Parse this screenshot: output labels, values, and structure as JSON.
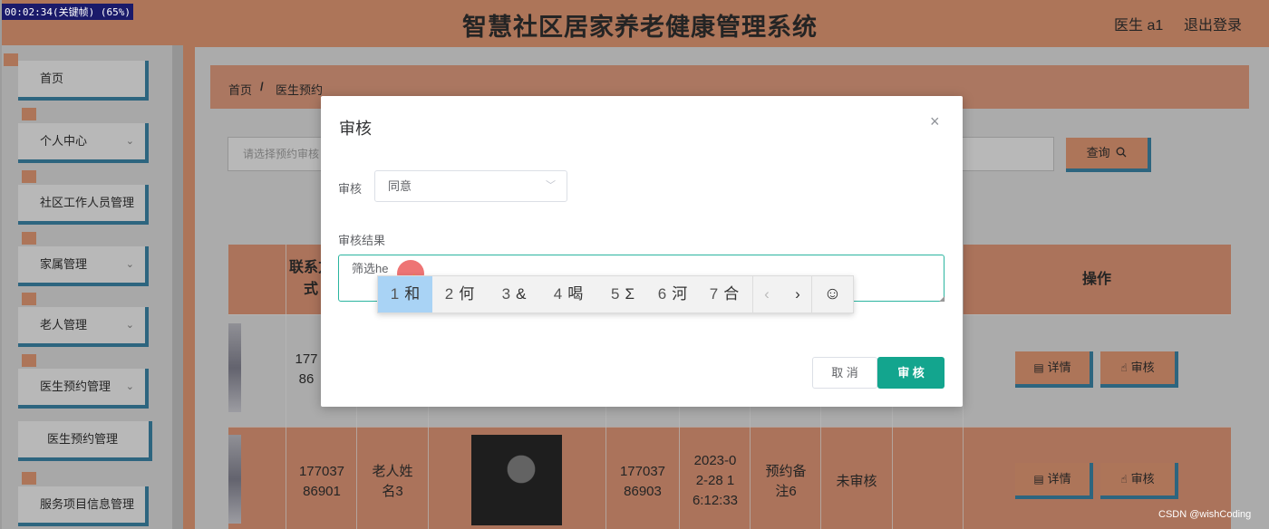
{
  "recording": "00:02:34(关键帧) (65%)",
  "header": {
    "title": "智慧社区居家养老健康管理系统",
    "user": "医生 a1",
    "logout": "退出登录"
  },
  "sidebar": {
    "items": [
      {
        "label": "首页"
      },
      {
        "label": "个人中心",
        "chevron": "⌄"
      },
      {
        "label": "社区工作人员管理"
      },
      {
        "label": "家属管理",
        "chevron": "⌄"
      },
      {
        "label": "老人管理",
        "chevron": "⌄"
      },
      {
        "label": "医生预约管理",
        "chevron": "⌄"
      },
      {
        "label": "医生预约管理"
      },
      {
        "label": "服务项目信息管理"
      }
    ]
  },
  "breadcrumb": {
    "home": "首页",
    "sep": "/",
    "current": "医生预约"
  },
  "search": {
    "placeholder": "请选择预约审核",
    "button": "查询",
    "icon": "search-icon"
  },
  "table": {
    "headers": {
      "contact": "联系方\n式",
      "actions": "操作"
    },
    "row1": {
      "phone": "177\n86"
    },
    "row2": {
      "phone": "177037\n86901",
      "elder_name": "老人姓\n名3",
      "doctor_phone": "177037\n86903",
      "time": "2023-0\n2-28 1\n6:12:33",
      "note": "预约备\n注6",
      "status": "未审核"
    },
    "detail_btn": "详情",
    "audit_btn": "审核"
  },
  "modal": {
    "title": "审核",
    "close": "×",
    "audit_label": "审核",
    "audit_value": "同意",
    "result_label": "审核结果",
    "result_text": "筛选he",
    "cancel": "取 消",
    "confirm": "审 核"
  },
  "ime": {
    "candidates": [
      {
        "num": "1",
        "text": "和"
      },
      {
        "num": "2",
        "text": "何"
      },
      {
        "num": "3",
        "text": "&"
      },
      {
        "num": "4",
        "text": "喝"
      },
      {
        "num": "5",
        "text": "Σ"
      },
      {
        "num": "6",
        "text": "河"
      },
      {
        "num": "7",
        "text": "合"
      }
    ],
    "prev": "‹",
    "next": "›",
    "emoji": "☺"
  },
  "watermark": "CSDN @wishCoding",
  "colors": {
    "accent": "#f0a27c",
    "border": "#3f8db0",
    "primary": "#13a58e",
    "ime_selected": "#a9d3f5"
  }
}
